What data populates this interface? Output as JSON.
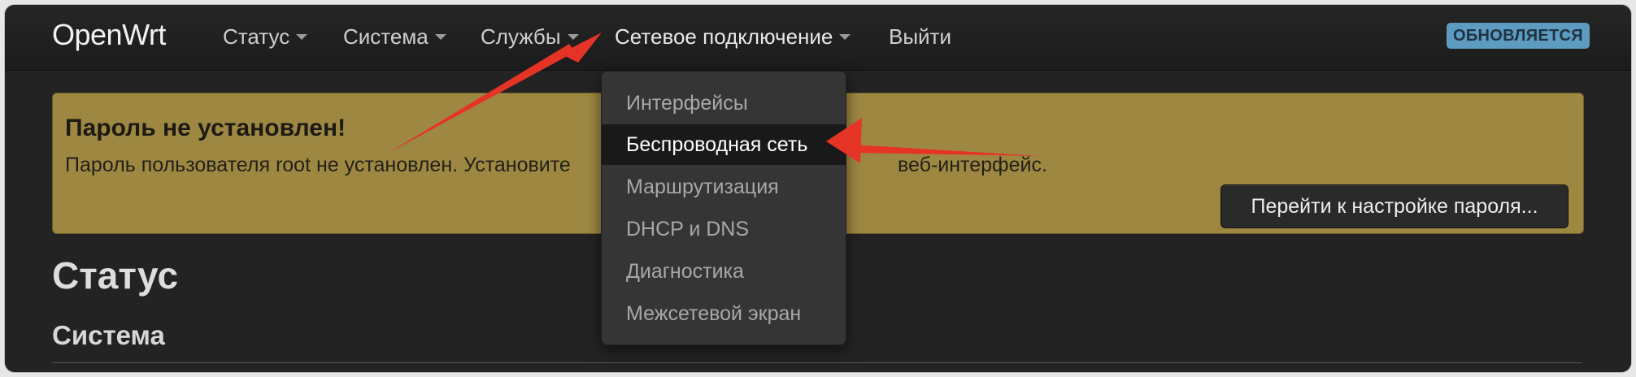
{
  "navbar": {
    "brand": "OpenWrt",
    "menus": [
      {
        "label": "Статус"
      },
      {
        "label": "Система"
      },
      {
        "label": "Службы"
      },
      {
        "label": "Сетевое подключение"
      },
      {
        "label": "Выйти"
      }
    ],
    "status_badge": "ОБНОВЛЯЕТСЯ"
  },
  "alert": {
    "title": "Пароль не установлен!",
    "text_left": "Пароль пользователя root не установлен. Установите",
    "text_right": "веб-интерфейс.",
    "button_label": "Перейти к настройке пароля..."
  },
  "main": {
    "page_title": "Статус",
    "section_title": "Система"
  },
  "dropdown": {
    "items": [
      {
        "label": "Интерфейсы"
      },
      {
        "label": "Беспроводная сеть"
      },
      {
        "label": "Маршрутизация"
      },
      {
        "label": "DHCP и DNS"
      },
      {
        "label": "Диагностика"
      },
      {
        "label": "Межсетевой экран"
      }
    ],
    "active_item": "Беспроводная сеть"
  },
  "colors": {
    "navbar_bg": "#1f1f1f",
    "alert_bg": "#9e8841",
    "badge_bg": "#5d9bc0",
    "annotation_arrow": "#e53325"
  }
}
